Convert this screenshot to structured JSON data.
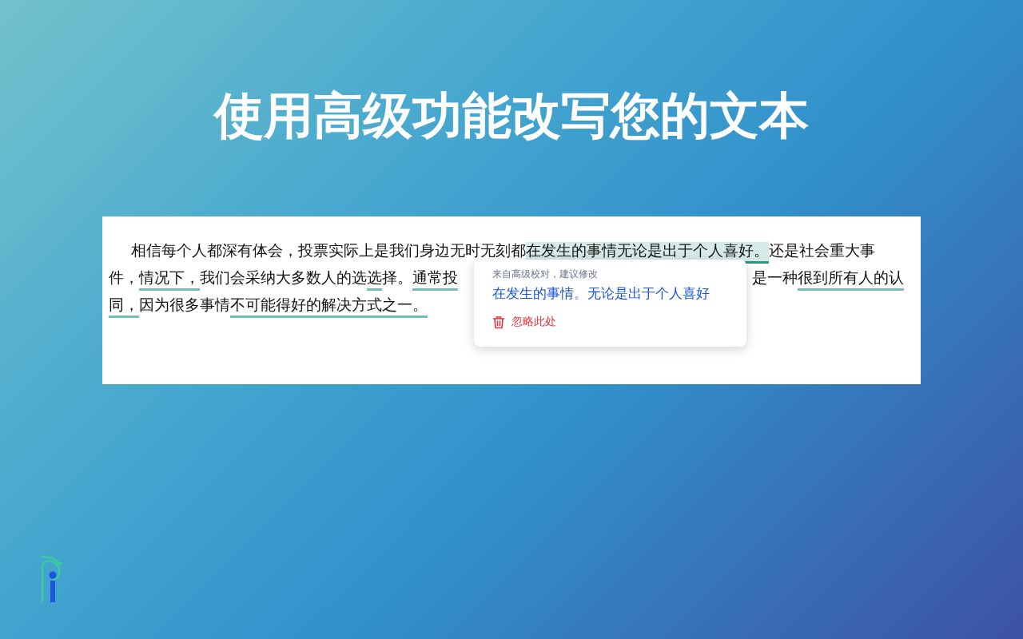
{
  "headline": "使用高级功能改写您的文本",
  "document": {
    "lines": [
      {
        "segments": [
          {
            "text": "相信每个人都深有体会，投票实际上是我们身边无时无刻都",
            "flagged": false,
            "selected": false
          },
          {
            "text": "在发生的事情无论是出于个人喜好。",
            "flagged": true,
            "selected": true
          },
          {
            "text": "还是社会重大事",
            "flagged": false,
            "selected": false
          }
        ]
      },
      {
        "segments": [
          {
            "text": "件，",
            "flagged": false,
            "selected": false
          },
          {
            "text": "情况下，",
            "flagged": true,
            "selected": false
          },
          {
            "text": "我们会采纳大多数人的选",
            "flagged": false,
            "selected": false
          },
          {
            "text": "选",
            "flagged": true,
            "selected": false
          },
          {
            "text": "择。",
            "flagged": false,
            "selected": false
          },
          {
            "text": "通常投",
            "flagged": true,
            "selected": false
          }
        ],
        "after_popup": [
          {
            "text": "是一种",
            "flagged": false,
            "selected": false
          },
          {
            "text": "很到所有人的认",
            "flagged": true,
            "selected": false
          }
        ]
      },
      {
        "segments": [
          {
            "text": "同，",
            "flagged": true,
            "selected": false
          },
          {
            "text": "因为很多事情",
            "flagged": false,
            "selected": false
          },
          {
            "text": "不可能得好的解决方式之一。",
            "flagged": true,
            "selected": false
          }
        ]
      }
    ]
  },
  "popup": {
    "source": "来自高级校对，建议修改",
    "suggestion": "在发生的事情。无论是出于个人喜好",
    "ignore": "忽略此处"
  }
}
